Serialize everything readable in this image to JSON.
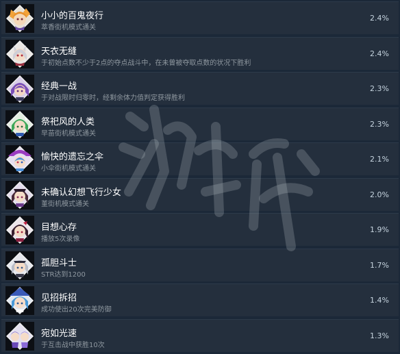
{
  "achievements": [
    {
      "title": "小小的百鬼夜行",
      "desc": "萃香街机模式通关",
      "pct": "2.4%",
      "icon": "character-portrait-suika"
    },
    {
      "title": "天衣无缝",
      "desc": "于初始点数不少于2点的夺点战斗中，在未曾被夺取点数的状况下胜利",
      "pct": "2.4%",
      "icon": "character-portrait-white-hair"
    },
    {
      "title": "经典一战",
      "desc": "于对战限时归零时，经剩余体力值判定获得胜利",
      "pct": "2.3%",
      "icon": "character-portrait-purple-hair"
    },
    {
      "title": "祭祀风的人类",
      "desc": "早苗街机模式通关",
      "pct": "2.3%",
      "icon": "character-portrait-sanae"
    },
    {
      "title": "愉快的遗忘之伞",
      "desc": "小伞街机模式通关",
      "pct": "2.1%",
      "icon": "character-portrait-kogasa"
    },
    {
      "title": "未确认幻想飞行少女",
      "desc": "堇街机模式通关",
      "pct": "2.0%",
      "icon": "character-portrait-sumireko"
    },
    {
      "title": "目想心存",
      "desc": "播放5次录像",
      "pct": "1.9%",
      "icon": "character-portrait-dark-hair"
    },
    {
      "title": "孤胆斗士",
      "desc": "STR达到1200",
      "pct": "1.7%",
      "icon": "character-portrait-silver-hair"
    },
    {
      "title": "见招拆招",
      "desc": "成功使出20次完美防御",
      "pct": "1.4%",
      "icon": "character-portrait-blue-hair"
    },
    {
      "title": "宛如光速",
      "desc": "于互击战中获胜10次",
      "pct": "1.3%",
      "icon": "character-portrait-twins"
    }
  ],
  "colors": {
    "background": "#1b2838",
    "row": "#242f3d",
    "title": "#ffffff",
    "desc": "#8f98a0",
    "pct": "#c6d4df"
  }
}
